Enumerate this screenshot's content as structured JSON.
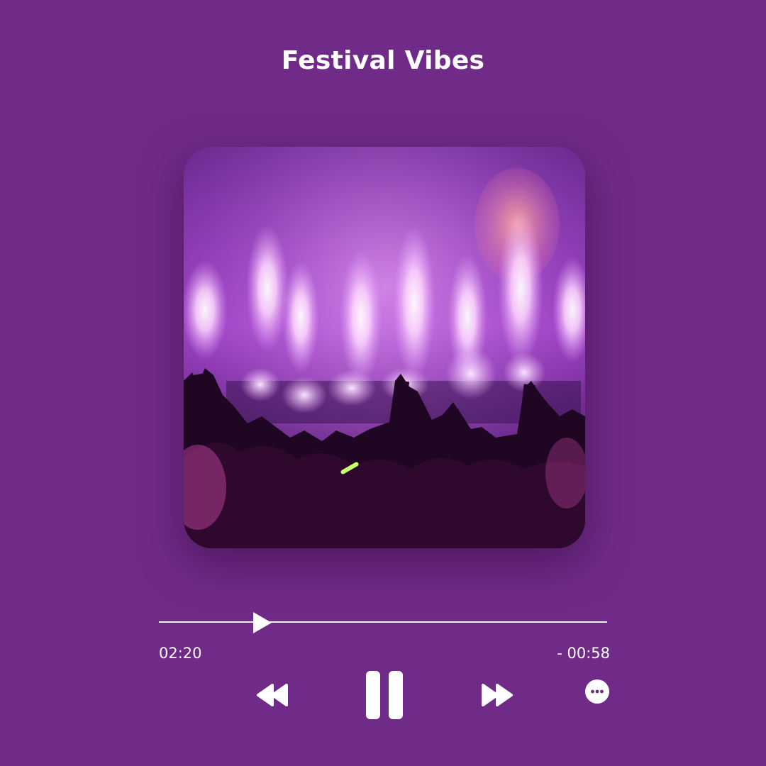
{
  "player": {
    "title": "Festival Vibes",
    "elapsed": "02:20",
    "remaining": "- 00:58",
    "progress_fraction": 0.21,
    "state": "playing"
  },
  "artwork": {
    "description_icon": "concert-photo"
  },
  "controls": {
    "rewind_icon": "rewind-icon",
    "pause_icon": "pause-icon",
    "forward_icon": "fast-forward-icon",
    "more_icon": "more-options-icon"
  },
  "colors": {
    "background": "#702b88",
    "foreground": "#ffffff"
  }
}
